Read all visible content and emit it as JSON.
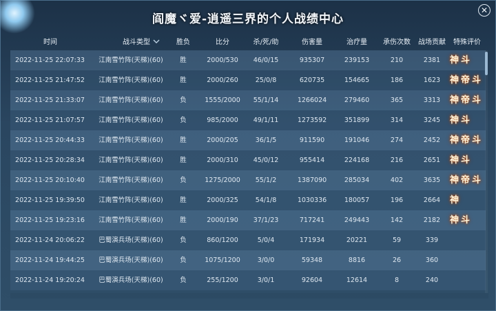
{
  "window": {
    "title": "阎魔ヾ爱-逍遥三界的个人战绩中心",
    "close_symbol": "✕"
  },
  "columns": {
    "time": "时间",
    "battle_type": "战斗类型",
    "result": "胜负",
    "score": "比分",
    "kda": "杀/死/助",
    "damage": "伤害量",
    "heal": "治疗量",
    "hits_taken": "承伤次数",
    "contribution": "战场贡献",
    "rating": "特殊评价"
  },
  "rows": [
    {
      "time": "2022-11-25 22:07:33",
      "battle_type": "江南雪竹阵(天梯)(60)",
      "result": "胜",
      "score": "2000/530",
      "kda": "46/0/15",
      "damage": "935307",
      "heal": "239153",
      "hits_taken": "210",
      "contribution": "2381",
      "rating": "神斗"
    },
    {
      "time": "2022-11-25 21:47:52",
      "battle_type": "江南雪竹阵(天梯)(60)",
      "result": "胜",
      "score": "2000/260",
      "kda": "25/0/8",
      "damage": "620735",
      "heal": "154665",
      "hits_taken": "186",
      "contribution": "1623",
      "rating": "神帝斗"
    },
    {
      "time": "2022-11-25 21:33:07",
      "battle_type": "江南雪竹阵(天梯)(60)",
      "result": "负",
      "score": "1555/2000",
      "kda": "55/1/14",
      "damage": "1266024",
      "heal": "279460",
      "hits_taken": "365",
      "contribution": "3313",
      "rating": "神帝斗"
    },
    {
      "time": "2022-11-25 21:07:57",
      "battle_type": "江南雪竹阵(天梯)(60)",
      "result": "负",
      "score": "985/2000",
      "kda": "49/1/11",
      "damage": "1273592",
      "heal": "351899",
      "hits_taken": "314",
      "contribution": "3245",
      "rating": "神斗"
    },
    {
      "time": "2022-11-25 20:44:33",
      "battle_type": "江南雪竹阵(天梯)(60)",
      "result": "胜",
      "score": "2000/205",
      "kda": "36/1/5",
      "damage": "911590",
      "heal": "191046",
      "hits_taken": "274",
      "contribution": "2452",
      "rating": "神帝斗"
    },
    {
      "time": "2022-11-25 20:28:34",
      "battle_type": "江南雪竹阵(天梯)(60)",
      "result": "胜",
      "score": "2000/310",
      "kda": "45/0/12",
      "damage": "955414",
      "heal": "224168",
      "hits_taken": "216",
      "contribution": "2651",
      "rating": "神斗"
    },
    {
      "time": "2022-11-25 20:10:40",
      "battle_type": "江南雪竹阵(天梯)(60)",
      "result": "负",
      "score": "1275/2000",
      "kda": "55/1/2",
      "damage": "1387090",
      "heal": "285034",
      "hits_taken": "402",
      "contribution": "3635",
      "rating": "神帝斗"
    },
    {
      "time": "2022-11-25 19:39:50",
      "battle_type": "江南雪竹阵(天梯)(60)",
      "result": "胜",
      "score": "2000/325",
      "kda": "54/1/8",
      "damage": "1030336",
      "heal": "180057",
      "hits_taken": "196",
      "contribution": "2664",
      "rating": "神"
    },
    {
      "time": "2022-11-25 19:23:16",
      "battle_type": "江南雪竹阵(天梯)(60)",
      "result": "胜",
      "score": "2000/190",
      "kda": "37/1/23",
      "damage": "717241",
      "heal": "249443",
      "hits_taken": "142",
      "contribution": "2182",
      "rating": "神斗"
    },
    {
      "time": "2022-11-24 20:06:22",
      "battle_type": "巴蜀演兵场(天梯)(60)",
      "result": "负",
      "score": "860/1200",
      "kda": "5/0/4",
      "damage": "171934",
      "heal": "20221",
      "hits_taken": "59",
      "contribution": "339",
      "rating": ""
    },
    {
      "time": "2022-11-24 19:44:25",
      "battle_type": "巴蜀演兵场(天梯)(60)",
      "result": "负",
      "score": "1075/1200",
      "kda": "3/0/0",
      "damage": "59348",
      "heal": "8816",
      "hits_taken": "26",
      "contribution": "360",
      "rating": ""
    },
    {
      "time": "2022-11-24 19:20:24",
      "battle_type": "巴蜀演兵场(天梯)(60)",
      "result": "负",
      "score": "255/1200",
      "kda": "3/0/1",
      "damage": "92604",
      "heal": "12614",
      "hits_taken": "8",
      "contribution": "240",
      "rating": ""
    }
  ]
}
